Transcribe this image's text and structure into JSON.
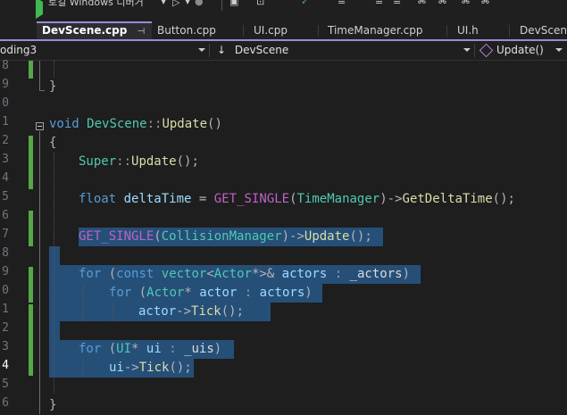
{
  "toolbar": {
    "config_label": "로컬 Windows 디버거"
  },
  "tabs": [
    {
      "label": "DevScene.cpp",
      "pin": "⊣",
      "close": "✕",
      "active": true
    },
    {
      "label": "Button.cpp"
    },
    {
      "label": "UI.cpp"
    },
    {
      "label": "TimeManager.cpp"
    },
    {
      "label": "UI.h"
    },
    {
      "label": "DevScene"
    }
  ],
  "navbar": {
    "project": "oding3",
    "scope": "DevScene",
    "scope_icon": "↓",
    "member": "Update()"
  },
  "editor": {
    "line_numbers": [
      "8",
      "9",
      "0",
      "1",
      "2",
      "3",
      "4",
      "5",
      "6",
      "7",
      "8",
      "9",
      "0",
      "1",
      "2",
      "3",
      "4",
      "5",
      "6"
    ],
    "current_line_index": 16,
    "code": {
      "l2_void": "void",
      "l2_class": "DevScene",
      "l2_scope": "::",
      "l2_func": "Update",
      "l2_parens": "()",
      "open_brace": "{",
      "close_brace": "}",
      "super": "Super",
      "scope_op": "::",
      "update": "Update",
      "call_end": "();",
      "float_kw": "float",
      "delta_var": "deltaTime",
      "assign": "=",
      "get_single": "GET_SINGLE",
      "open_paren": "(",
      "time_manager": "TimeManager",
      "arrow_close": ")->",
      "get_delta": "GetDeltaTime",
      "collision_manager": "CollisionManager",
      "for_kw": "for",
      "const_kw": "const",
      "vector": "vector",
      "lt": "<",
      "actor_type": "Actor",
      "ptr_gt_ref": "*>&",
      "actors_var": "actors",
      "colon": ":",
      "actors_field": "_actors",
      "close_paren": ")",
      "star": "*",
      "actor_var": "actor",
      "arrow": "->",
      "tick": "Tick",
      "ui_type": "UI",
      "ui_var": "ui",
      "uis_field": "_uis"
    }
  }
}
